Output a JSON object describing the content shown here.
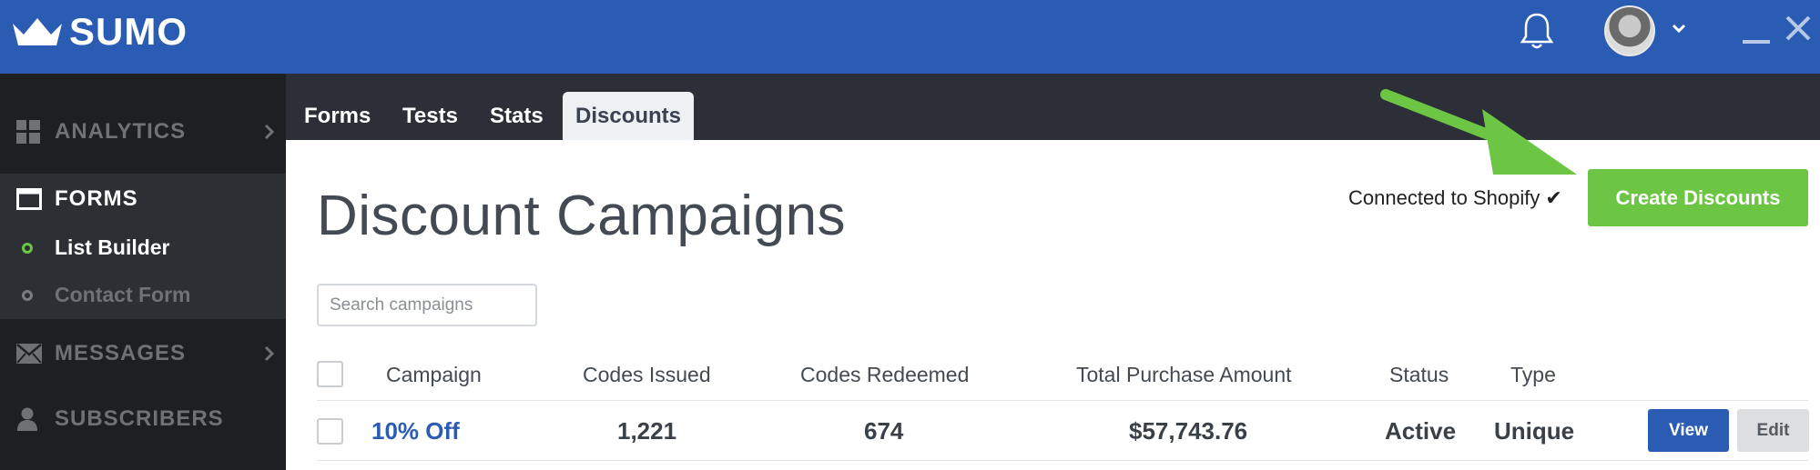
{
  "app": {
    "logo_text": "SUMO"
  },
  "header": {
    "icons": [
      "crown-logo-icon",
      "bell-icon",
      "avatar",
      "chevron-down-icon",
      "minimize-icon",
      "close-icon"
    ]
  },
  "sidebar": {
    "items": [
      {
        "label": "ANALYTICS",
        "icon": "grid-icon",
        "has_chevron": true
      },
      {
        "label": "FORMS",
        "icon": "window-icon",
        "active": true
      },
      {
        "label": "MESSAGES",
        "icon": "envelope-icon",
        "has_chevron": true
      },
      {
        "label": "SUBSCRIBERS",
        "icon": "person-icon"
      }
    ],
    "sub_items": [
      {
        "label": "List Builder",
        "active": true
      },
      {
        "label": "Contact Form",
        "active": false
      }
    ]
  },
  "tabs": [
    {
      "label": "Forms"
    },
    {
      "label": "Tests"
    },
    {
      "label": "Stats"
    },
    {
      "label": "Discounts",
      "active": true
    }
  ],
  "main": {
    "title": "Discount Campaigns",
    "connected_text": "Connected to Shopify",
    "connected_mark": "✔",
    "create_button": "Create Discounts",
    "search_placeholder": "Search campaigns",
    "columns": [
      "Campaign",
      "Codes Issued",
      "Codes Redeemed",
      "Total Purchase Amount",
      "Status",
      "Type"
    ],
    "rows": [
      {
        "campaign": "10% Off",
        "codes_issued": "1,221",
        "codes_redeemed": "674",
        "total_purchase_amount": "$57,743.76",
        "status": "Active",
        "type": "Unique",
        "view_label": "View",
        "edit_label": "Edit"
      }
    ]
  },
  "colors": {
    "brand_blue": "#2b5cb4",
    "sidebar_bg": "#1d1f22",
    "accent_green": "#6cc644",
    "tabbar_bg": "#2c2f38"
  }
}
